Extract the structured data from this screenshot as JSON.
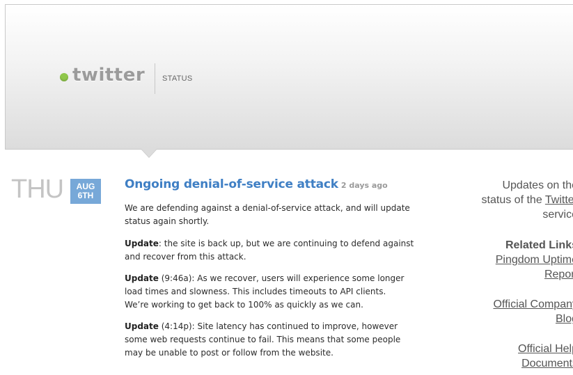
{
  "header": {
    "logo_text": "twitter",
    "section_label": "STATUS",
    "logo_color": "#8fc74a"
  },
  "date": {
    "day": "THU",
    "month": "AUG",
    "day_of_month": "6TH",
    "badge_color": "#77a8d8"
  },
  "post": {
    "title": "Ongoing denial-of-service attack",
    "time": "2 days ago",
    "title_color": "#3f7fc4",
    "paragraphs": [
      {
        "label": "",
        "stamp": "",
        "lines": [
          "We are defending against a denial-of-service attack, and will update",
          "status again shortly."
        ]
      },
      {
        "label": "Update",
        "stamp": "",
        "lines": [
          ": the site is back up, but we are continuing to defend against",
          "and recover from this attack."
        ]
      },
      {
        "label": "Update",
        "stamp": " (9:46a)",
        "lines": [
          ": As we recover, users will experience some longer",
          "load times and slowness. This includes timeouts to API clients.",
          "We’re working to get back to 100% as quickly as we can."
        ]
      },
      {
        "label": "Update",
        "stamp": " (4:14p)",
        "lines": [
          ": Site latency has continued to improve, however",
          "some web requests continue to fail. This means that some people",
          "may be unable to post or follow from the website."
        ]
      }
    ]
  },
  "sidebar": {
    "intro_line1": "Updates on the",
    "intro_prefix": "status of the ",
    "intro_link": "Twitter",
    "intro_line3": "service",
    "related_heading": "Related Links",
    "links": [
      {
        "line1": "Pingdom Uptime",
        "line2": "Report"
      },
      {
        "line1": "Official Company",
        "line2": "Blog"
      },
      {
        "line1": "Official Help",
        "line2": "Documents"
      }
    ]
  }
}
